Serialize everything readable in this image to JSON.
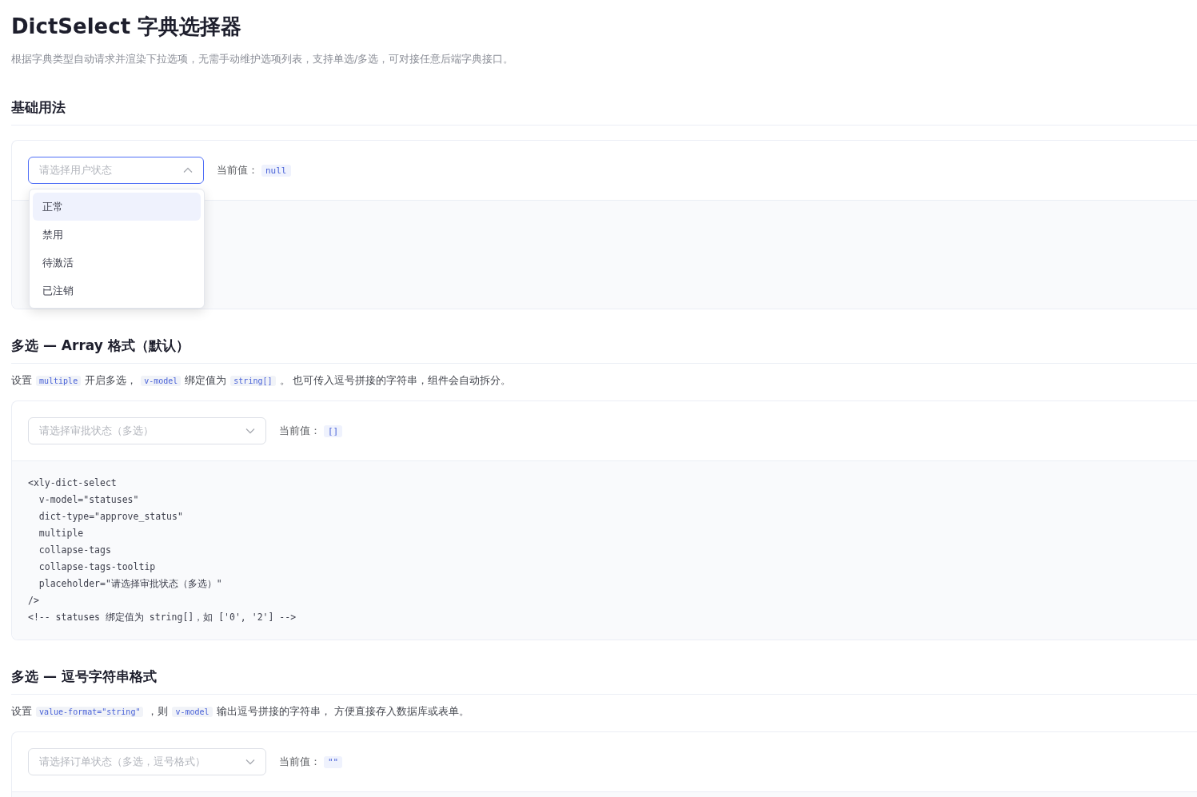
{
  "page": {
    "title": "DictSelect 字典选择器",
    "description": "根据字典类型自动请求并渲染下拉选项，无需手动维护选项列表，支持单选/多选，可对接任意后端字典接口。"
  },
  "sections": [
    {
      "title": "基础用法",
      "select": {
        "placeholder": "请选择用户状态",
        "open": true,
        "options": [
          {
            "label": "正常",
            "highlighted": true
          },
          {
            "label": "禁用",
            "highlighted": false
          },
          {
            "label": "待激活",
            "highlighted": false
          },
          {
            "label": "已注销",
            "highlighted": false
          }
        ]
      },
      "value_label": "当前值：",
      "value": "null"
    },
    {
      "title": "多选 — Array 格式（默认）",
      "description": [
        {
          "kind": "text",
          "text": "设置"
        },
        {
          "kind": "code",
          "text": "multiple"
        },
        {
          "kind": "text",
          "text": "开启多选，"
        },
        {
          "kind": "code",
          "text": "v-model"
        },
        {
          "kind": "text",
          "text": "绑定值为"
        },
        {
          "kind": "code",
          "text": "string[]"
        },
        {
          "kind": "text",
          "text": "。 也可传入逗号拼接的字符串，组件会自动拆分。"
        }
      ],
      "select": {
        "placeholder": "请选择审批状态（多选）",
        "open": false
      },
      "value_label": "当前值：",
      "value": "[]",
      "code": [
        "<xly-dict-select",
        "  v-model=\"statuses\"",
        "  dict-type=\"approve_status\"",
        "  multiple",
        "  collapse-tags",
        "  collapse-tags-tooltip",
        "  placeholder=\"请选择审批状态（多选）\"",
        "/>",
        "<!-- statuses 绑定值为 string[]，如 ['0', '2'] -->"
      ]
    },
    {
      "title": "多选 — 逗号字符串格式",
      "description": [
        {
          "kind": "text",
          "text": "设置"
        },
        {
          "kind": "code",
          "text": "value-format=\"string\""
        },
        {
          "kind": "text",
          "text": "，则"
        },
        {
          "kind": "code",
          "text": "v-model"
        },
        {
          "kind": "text",
          "text": "输出逗号拼接的字符串， 方便直接存入数据库或表单。"
        }
      ],
      "select": {
        "placeholder": "请选择订单状态（多选，逗号格式）",
        "open": false
      },
      "value_label": "当前值：",
      "value": "\"\""
    }
  ]
}
